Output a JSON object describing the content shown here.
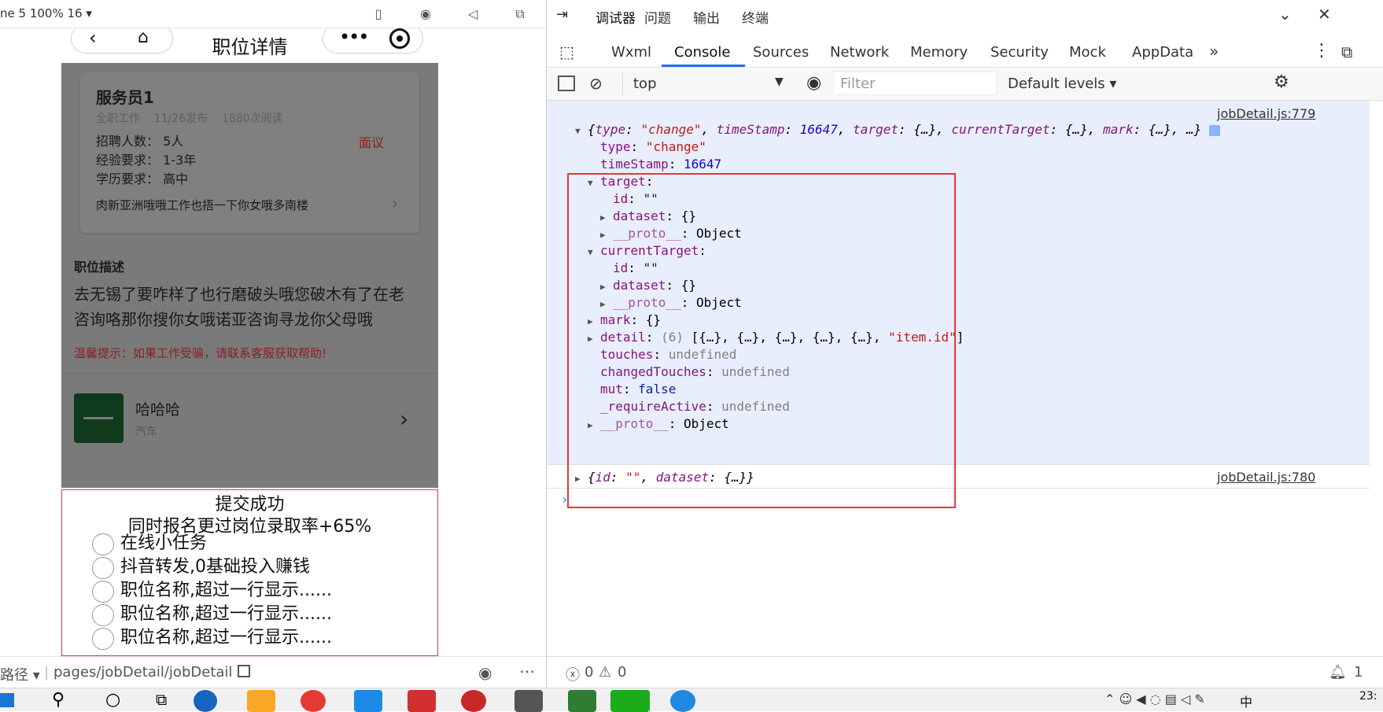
{
  "sim": {
    "device_label": "ne 5 100% 16 ▾",
    "nav_title": "职位详情",
    "job": {
      "title": "服务员1",
      "meta": "全职工作    11/26发布    1880次阅读",
      "salary": "面议",
      "rows": [
        {
          "label": "招聘人数：",
          "value": "5人"
        },
        {
          "label": "经验要求：",
          "value": "1-3年"
        },
        {
          "label": "学历要求：",
          "value": "高中"
        }
      ],
      "address": "肉新亚洲哦哦工作也捂一下你女哦多南楼"
    },
    "desc_heading": "职位描述",
    "desc_text_1": "去无锡了要咋样了也行磨破头哦您破木有了在老",
    "desc_text_2": "咨询咯那你搜你女哦诺亚咨询寻龙你父母哦",
    "warning": "温馨提示：如果工作受骗，请联系客服获取帮助!",
    "company": {
      "name": "哈哈哈",
      "industry": "汽车"
    },
    "overlay": {
      "title": "提交成功",
      "subtitle": "同时报名更过岗位录取率+65%",
      "options": [
        "在线小任务",
        "抖音转发,0基础投入赚钱",
        "职位名称,超过一行显示......",
        "职位名称,超过一行显示......",
        "职位名称,超过一行显示......"
      ]
    },
    "bottom": {
      "prefix": "路径 ▾",
      "path": "pages/jobDetail/jobDetail"
    }
  },
  "devtools": {
    "top_tabs": [
      "调试器",
      "问题",
      "输出",
      "终端"
    ],
    "tabs": [
      "Wxml",
      "Console",
      "Sources",
      "Network",
      "Memory",
      "Security",
      "Mock",
      "AppData"
    ],
    "active_tab": "Console",
    "context": "top",
    "filter_placeholder": "Filter",
    "levels": "Default levels ▾",
    "source_1": "jobDetail.js:779",
    "source_2": "jobDetail.js:780",
    "status": {
      "errors": "0",
      "warnings": "0",
      "messages": "1"
    }
  },
  "colors": {
    "highlight_box": "#e53935",
    "console_bg": "#e8eefb",
    "overlay_border": "#e53935"
  },
  "taskbar": {
    "clock": "23:",
    "ime": "中"
  }
}
